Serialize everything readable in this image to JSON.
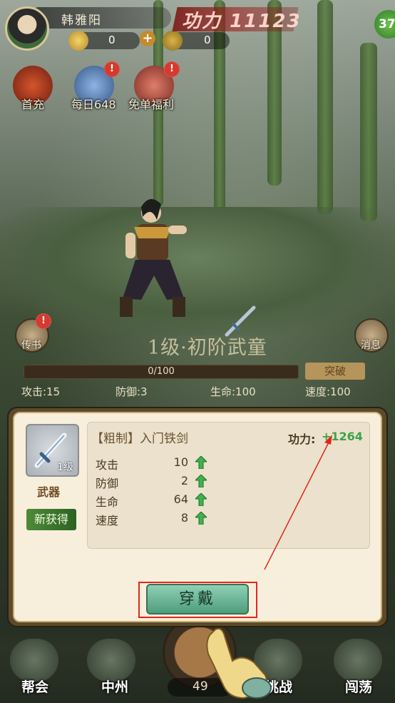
{
  "header": {
    "player_name": "韩雅阳",
    "power_label": "功力",
    "power_value": "11123",
    "currency1_value": "0",
    "currency2_value": "0",
    "level_badge": "37"
  },
  "top_buttons": [
    {
      "label": "首充",
      "badge": ""
    },
    {
      "label": "每日648",
      "badge": "!"
    },
    {
      "label": "免单福利",
      "badge": "!"
    }
  ],
  "side_buttons": {
    "left_label": "传书",
    "left_badge": "!",
    "right_label": "消息"
  },
  "character": {
    "realm": "1级·初阶武童",
    "xp_text": "0/100",
    "xp_progress": 0,
    "breakthrough_label": "突破",
    "stats": [
      "攻击:15",
      "防御:3",
      "生命:100",
      "速度:100"
    ]
  },
  "dialog": {
    "item_name": "【粗制】入门铁剑",
    "item_level": "1级",
    "item_type": "武器",
    "new_tag": "新获得",
    "power_label": "功力:",
    "power_gain": "+1264",
    "stats": [
      {
        "name": "攻击",
        "value": "10"
      },
      {
        "name": "防御",
        "value": "2"
      },
      {
        "name": "生命",
        "value": "64"
      },
      {
        "name": "速度",
        "value": "8"
      }
    ],
    "equip_label": "穿戴"
  },
  "bottom_nav": {
    "items": [
      "帮会",
      "中州",
      "挑战",
      "闯荡"
    ],
    "center_count": "49"
  },
  "colors": {
    "accent_green": "#3ea24a",
    "highlight_red": "#e2261c",
    "dialog_bg": "#f7efdc"
  }
}
